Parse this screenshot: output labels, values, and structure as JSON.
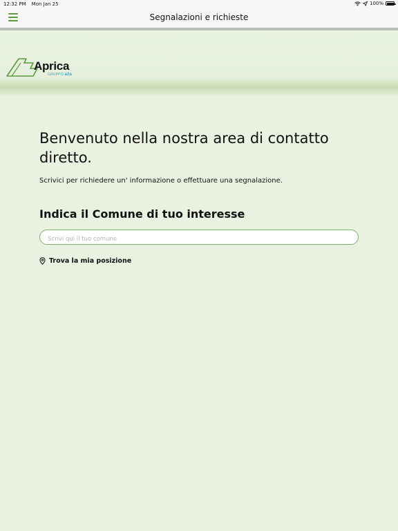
{
  "status_bar": {
    "time": "12:32 PM",
    "date": "Mon Jan 25",
    "battery": "100%"
  },
  "header": {
    "title": "Segnalazioni e richieste"
  },
  "logo": {
    "brand": "Aprica",
    "group_prefix": "GRUPPO",
    "group_name": "a2a"
  },
  "main": {
    "welcome": "Benvenuto nella nostra area di contatto diretto.",
    "subtitle": "Scrivici per richiedere un' informazione o effettuare una segnalazione.",
    "section_title": "Indica il Comune di tuo interesse",
    "search_placeholder": "Scrivi qui il tuo comune",
    "locate_label": "Trova la mia posizione"
  },
  "icons": {
    "menu": "hamburger-menu-icon",
    "location": "location-pin-icon",
    "wifi": "wifi-icon",
    "location_arrow": "location-arrow-icon",
    "battery": "battery-icon"
  },
  "colors": {
    "background": "#e9f2e1",
    "accent": "#5a9a3c",
    "input_border": "#7fb069",
    "logo_sub": "#2aa7c9"
  }
}
